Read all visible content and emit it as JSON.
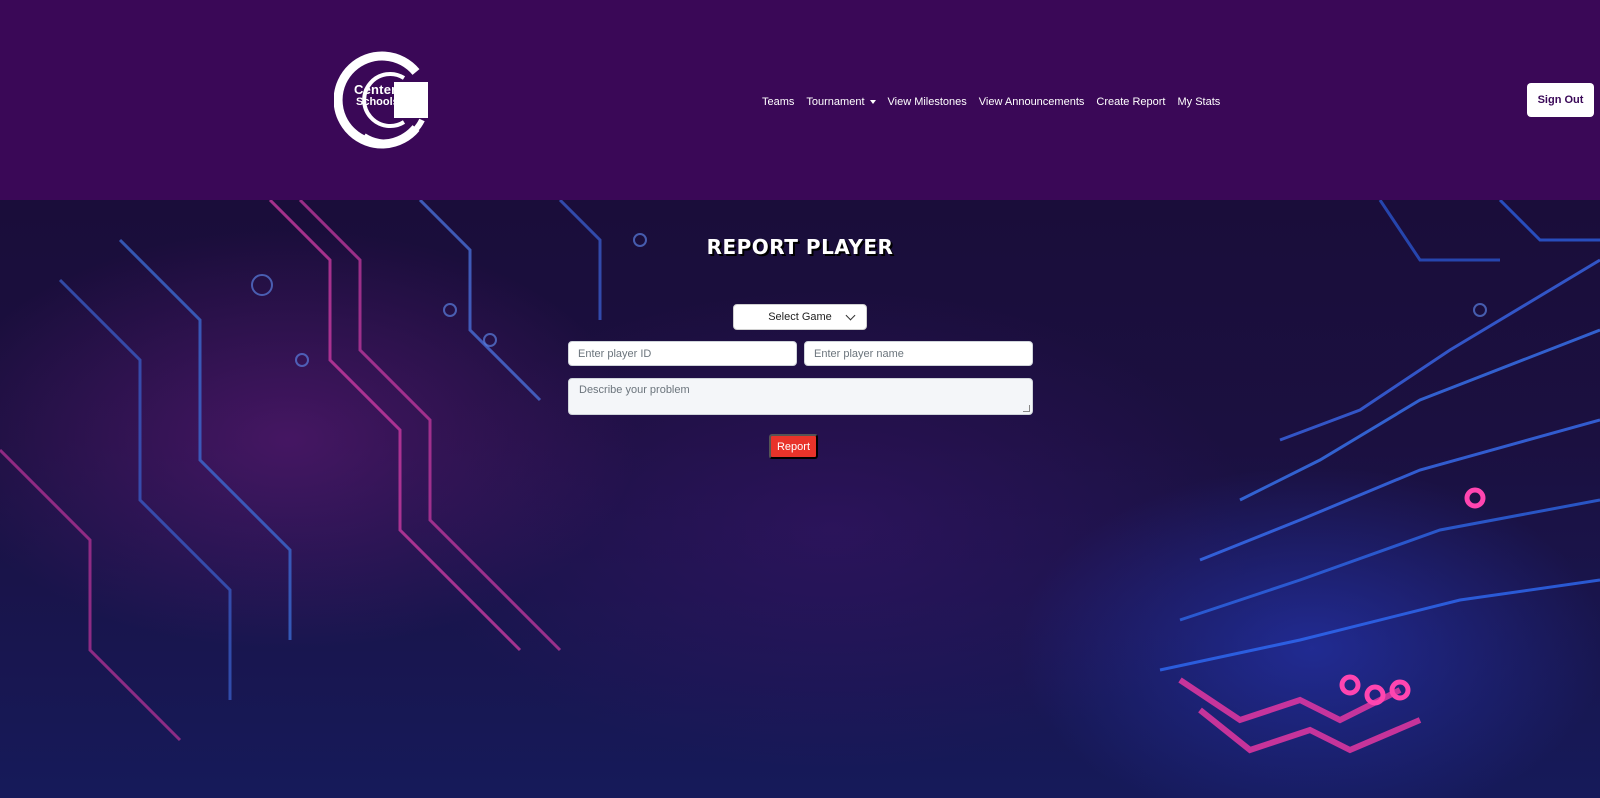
{
  "brand": {
    "logo_line1": "Centennial",
    "logo_line2": "Schools"
  },
  "nav": {
    "items": [
      {
        "label": "Teams"
      },
      {
        "label": "Tournament",
        "has_dropdown": true
      },
      {
        "label": "View Milestones"
      },
      {
        "label": "View Announcements"
      },
      {
        "label": "Create Report"
      },
      {
        "label": "My Stats"
      }
    ],
    "signout_label": "Sign Out"
  },
  "form": {
    "title": "REPORT PLAYER",
    "game_select": {
      "selected": "Select Game"
    },
    "player_id": {
      "value": "",
      "placeholder": "Enter player ID"
    },
    "player_name": {
      "value": "",
      "placeholder": "Enter player name"
    },
    "problem": {
      "value": "",
      "placeholder": "Describe your problem"
    },
    "submit_label": "Report"
  },
  "colors": {
    "header_bg": "#3a0857",
    "accent": "#e8332a",
    "signout_text": "#3a0857"
  },
  "icons": {
    "logo": "centennial-c-logo",
    "select_chevron": "chevron-down-icon",
    "dropdown_caret": "caret-down-icon"
  }
}
